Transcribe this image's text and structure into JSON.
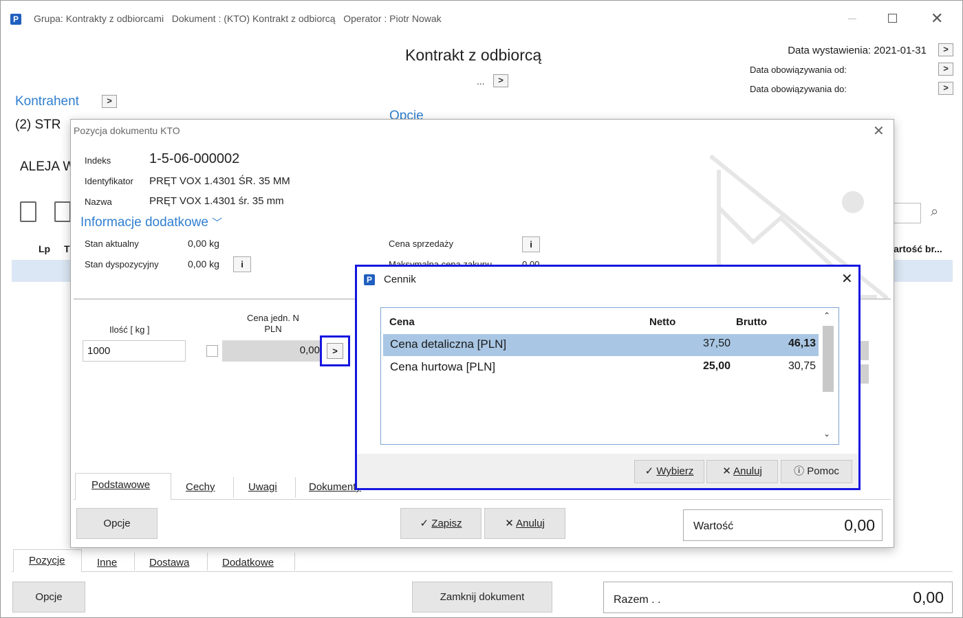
{
  "window": {
    "title": "Grupa: Kontrakty z odbiorcami   Dokument : (KTO) Kontrakt z odbiorcą   Operator : Piotr Nowak",
    "doc_title": "Kontrakt z odbiorcą",
    "dots": "...",
    "date_issue_label": "Data wystawienia: 2021-01-31",
    "valid_from_label": "Data obowiązywania od:",
    "valid_to_label": "Data obowiązywania do:",
    "contractor_label": "Kontrahent",
    "options_label": "Opcje",
    "contractor_name": "(2) STR",
    "address": "ALEJA W",
    "col_lp": "Lp",
    "col_t": "T",
    "col_value": "artość br...",
    "tabs": [
      "Pozycje",
      "Inne",
      "Dostawa",
      "Dodatkowe"
    ],
    "options_button": "Opcje",
    "close_doc_button": "Zamknij dokument",
    "total_label": "Razem . .",
    "total_value": "0,00"
  },
  "dialog": {
    "title": "Pozycja dokumentu KTO",
    "index_label": "Indeks",
    "index_value": "1-5-06-000002",
    "identifier_label": "Identyfikator",
    "identifier_value": "PRĘT VOX 1.4301 ŚR. 35 MM",
    "name_label": "Nazwa",
    "name_value": "PRĘT VOX 1.4301 śr. 35 mm",
    "more_info": "Informacje dodatkowe",
    "stock_current_label": "Stan aktualny",
    "stock_current_value": "0,00  kg",
    "stock_available_label": "Stan dyspozycyjny",
    "stock_available_value": "0,00  kg",
    "sale_price_label": "Cena sprzedaży",
    "max_price_partial": "Maksymalna cena zakupu",
    "max_price_value": "0,00",
    "qty_label": "Ilość  [ kg ]",
    "qty_value": "1000",
    "unit_price_label_1": "Cena jedn. N",
    "unit_price_label_2": "PLN",
    "unit_price_value": "0,00",
    "tabs": [
      "Podstawowe",
      "Cechy",
      "Uwagi",
      "Dokumenty"
    ],
    "options_button": "Opcje",
    "save_button": "Zapisz",
    "cancel_button": "Anuluj",
    "value_label": "Wartość",
    "value_amount": "0,00"
  },
  "cennik": {
    "title": "Cennik",
    "col_price": "Cena",
    "col_net": "Netto",
    "col_gross": "Brutto",
    "rows": [
      {
        "name": "Cena detaliczna [PLN]",
        "net": "37,50",
        "gross": "46,13"
      },
      {
        "name": "Cena hurtowa [PLN]",
        "net": "25,00",
        "gross": "30,75"
      }
    ],
    "select_button": "Wybierz",
    "cancel_button": "Anuluj",
    "help_button": "Pomoc"
  },
  "colors": {
    "accent_blue": "#2f7fd0",
    "highlight_border": "#1515e0",
    "selected_row": "#a9c7e4"
  }
}
